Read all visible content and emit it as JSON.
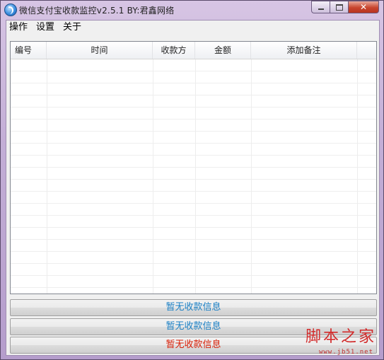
{
  "window": {
    "title": "微信支付宝收款监控v2.5.1  BY:君鑫网络",
    "close_glyph": "✕"
  },
  "menu": {
    "items": [
      "操作",
      "设置",
      "关于"
    ]
  },
  "list": {
    "columns": [
      "编号",
      "时间",
      "收款方",
      "金额",
      "添加备注"
    ],
    "rows": []
  },
  "status": {
    "line1": "暂无收款信息",
    "line2": "暂无收款信息",
    "line3": "暂无收款信息",
    "color_info": "#1a7fc4",
    "color_alert": "#d81e06"
  },
  "watermark": {
    "text": "脚本之家",
    "url": "www.jb51.net"
  }
}
